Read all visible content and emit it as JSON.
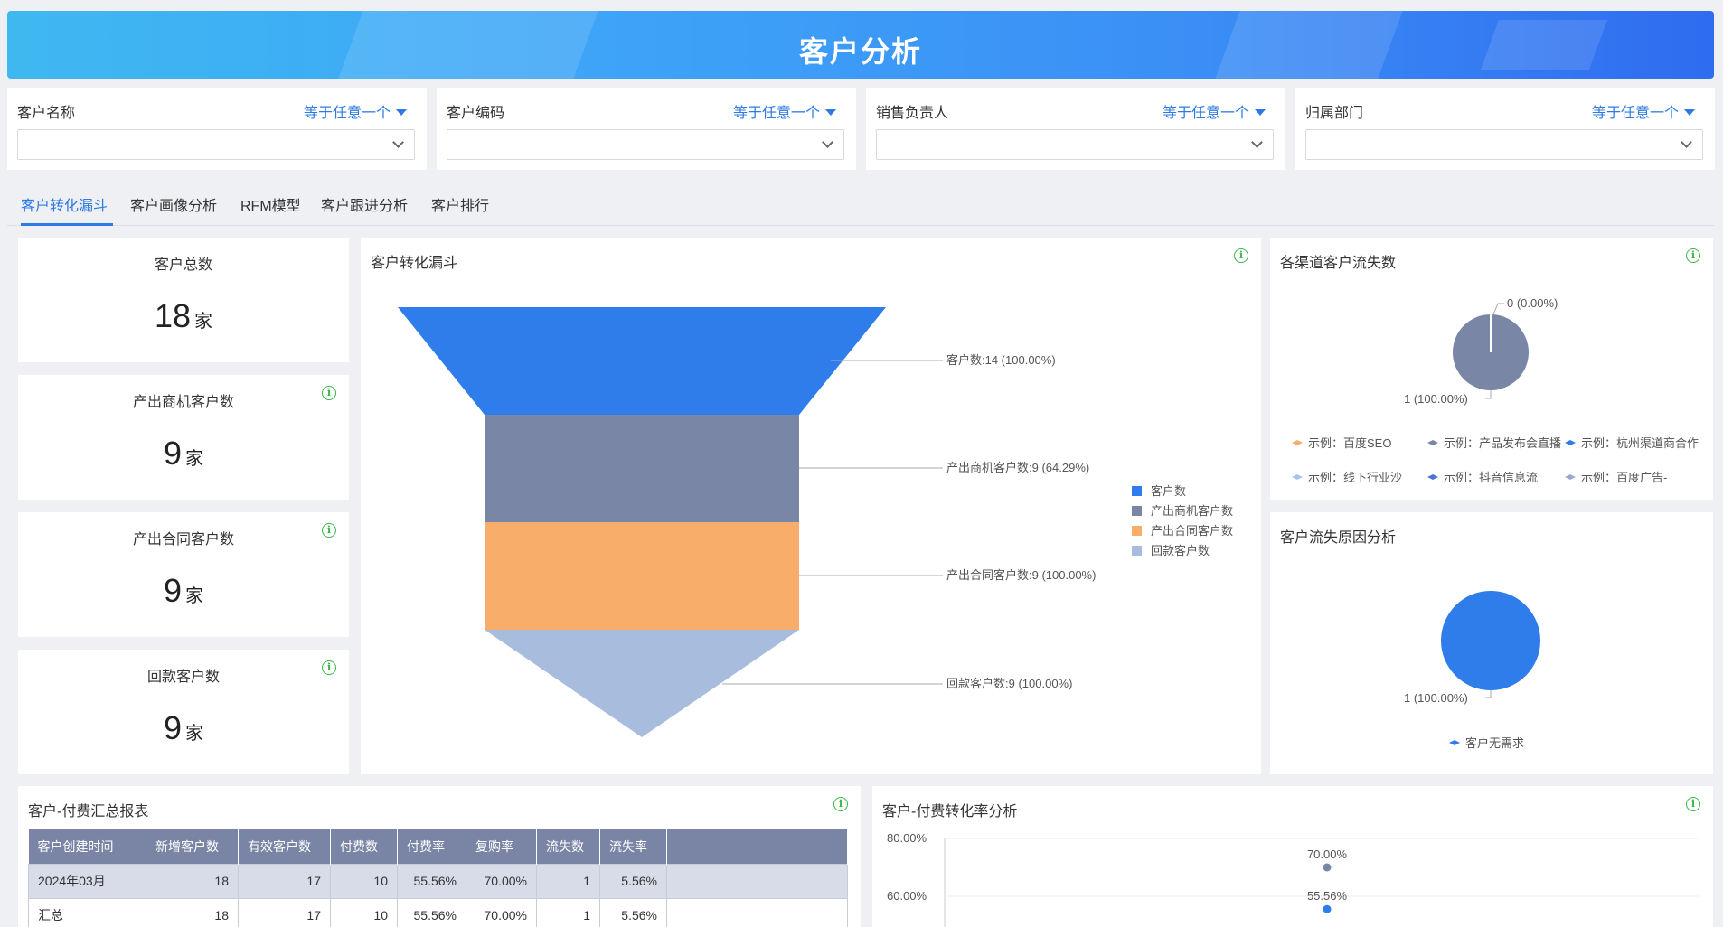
{
  "header": {
    "title": "客户分析"
  },
  "filters": [
    {
      "label": "客户名称",
      "operator": "等于任意一个",
      "value": ""
    },
    {
      "label": "客户编码",
      "operator": "等于任意一个",
      "value": ""
    },
    {
      "label": "销售负责人",
      "operator": "等于任意一个",
      "value": ""
    },
    {
      "label": "归属部门",
      "operator": "等于任意一个",
      "value": ""
    }
  ],
  "tabs": [
    {
      "label": "客户转化漏斗",
      "active": true
    },
    {
      "label": "客户画像分析"
    },
    {
      "label": "RFM模型"
    },
    {
      "label": "客户跟进分析"
    },
    {
      "label": "客户排行"
    }
  ],
  "kpis": [
    {
      "title": "客户总数",
      "value": "18",
      "unit": "家"
    },
    {
      "title": "产出商机客户数",
      "value": "9",
      "unit": "家"
    },
    {
      "title": "产出合同客户数",
      "value": "9",
      "unit": "家"
    },
    {
      "title": "回款客户数",
      "value": "9",
      "unit": "家"
    }
  ],
  "funnel": {
    "title": "客户转化漏斗",
    "labels": [
      "客户数:14 (100.00%)",
      "产出商机客户数:9 (64.29%)",
      "产出合同客户数:9 (100.00%)",
      "回款客户数:9 (100.00%)"
    ],
    "legend": [
      "客户数",
      "产出商机客户数",
      "产出合同客户数",
      "回款客户数"
    ],
    "colors": [
      "#2f7deb",
      "#7a86a6",
      "#f8ae6a",
      "#a8bcdd"
    ]
  },
  "channel_loss": {
    "title": "各渠道客户流失数",
    "label_top": "0 (0.00%)",
    "label_bottom": "1 (100.00%)",
    "legend": [
      "示例：百度SEO",
      "示例：产品发布会直播",
      "示例：杭州渠道商合作",
      "示例：线下行业沙",
      "示例：抖音信息流",
      "示例：百度广告-"
    ],
    "legend_colors": [
      "#f8ae6a",
      "#7a86a6",
      "#2f7deb",
      "#a8c4ee",
      "#4a74d8",
      "#9aabc8"
    ]
  },
  "loss_reason": {
    "title": "客户流失原因分析",
    "label": "1 (100.00%)",
    "legend": [
      "客户无需求"
    ]
  },
  "pay_table": {
    "title": "客户-付费汇总报表",
    "columns": [
      "客户创建时间",
      "新增客户数",
      "有效客户数",
      "付费数",
      "付费率",
      "复购率",
      "流失数",
      "流失率"
    ],
    "rows": [
      [
        "2024年03月",
        "18",
        "17",
        "10",
        "55.56%",
        "70.00%",
        "1",
        "5.56%"
      ],
      [
        "汇总",
        "18",
        "17",
        "10",
        "55.56%",
        "70.00%",
        "1",
        "5.56%"
      ]
    ]
  },
  "chart_data": {
    "type": "scatter",
    "title": "客户-付费转化率分析",
    "y_ticks": [
      "80.00%",
      "60.00%"
    ],
    "ylim": [
      0.6,
      0.8
    ],
    "points": [
      {
        "label": "70.00%",
        "value": 0.7
      },
      {
        "label": "55.56%",
        "value": 0.5556
      }
    ]
  }
}
